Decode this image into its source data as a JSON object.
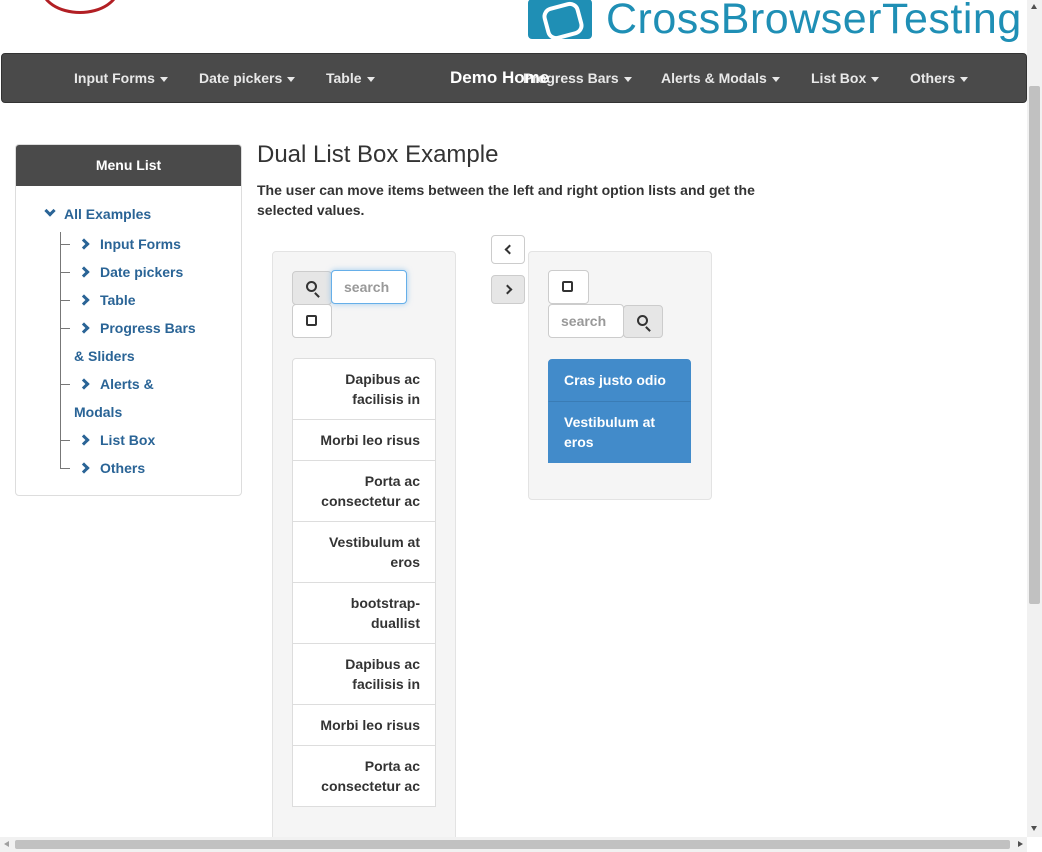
{
  "header": {
    "brand_text": "CrossBrowserTesting"
  },
  "navbar": {
    "brand": "Demo Home",
    "items": [
      {
        "label": "Input Forms"
      },
      {
        "label": "Date pickers"
      },
      {
        "label": "Table"
      },
      {
        "label": "Progress Bars"
      },
      {
        "label": "Alerts & Modals"
      },
      {
        "label": "List Box"
      },
      {
        "label": "Others"
      }
    ]
  },
  "sidebar": {
    "title": "Menu List",
    "root": "All Examples",
    "items": [
      {
        "label": "Input Forms"
      },
      {
        "label": "Date pickers"
      },
      {
        "label": "Table"
      },
      {
        "label": "Progress Bars & Sliders"
      },
      {
        "label": "Alerts & Modals"
      },
      {
        "label": "List Box"
      },
      {
        "label": "Others"
      }
    ]
  },
  "main": {
    "title": "Dual List Box Example",
    "description": "The user can move items between the left and right option lists and get the selected values."
  },
  "left_list": {
    "search_placeholder": "search",
    "items": [
      "Dapibus ac facilisis in",
      "Morbi leo risus",
      "Porta ac consectetur ac",
      "Vestibulum at eros",
      "bootstrap-duallist",
      "Dapibus ac facilisis in",
      "Morbi leo risus",
      "Porta ac consectetur ac"
    ]
  },
  "right_list": {
    "search_placeholder": "search",
    "items": [
      "Cras justo odio",
      "Vestibulum at eros"
    ]
  },
  "colors": {
    "navbar": "#4a4a4a",
    "link": "#2a6496",
    "active_item": "#428bca",
    "brand": "#1f8fb5"
  }
}
